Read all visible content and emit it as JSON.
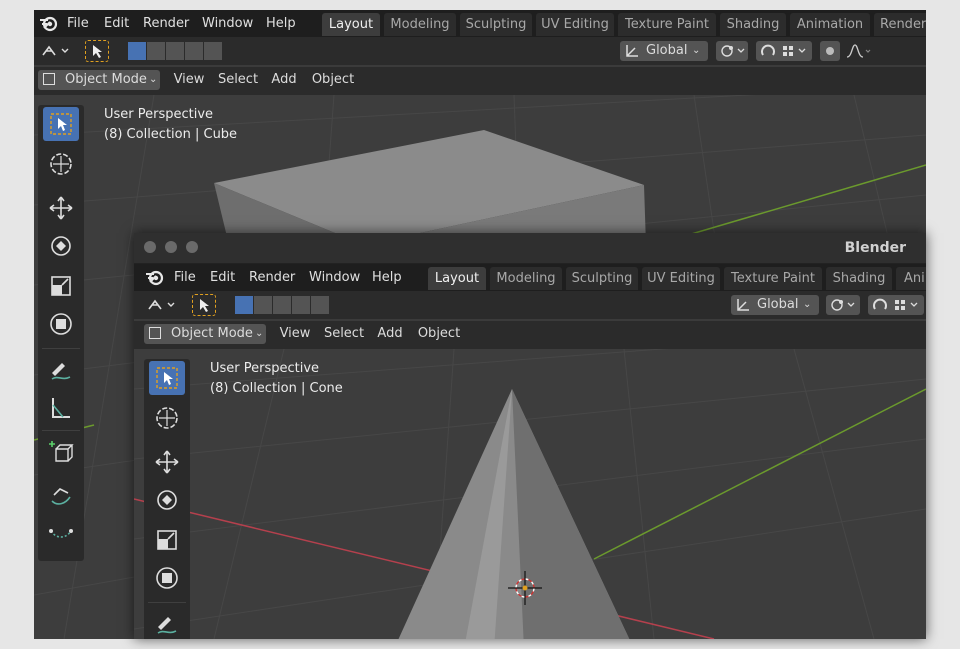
{
  "app": {
    "title": "Blender"
  },
  "menu": {
    "file": "File",
    "edit": "Edit",
    "render": "Render",
    "window": "Window",
    "help": "Help"
  },
  "workspace_tabs": [
    "Layout",
    "Modeling",
    "Sculpting",
    "UV Editing",
    "Texture Paint",
    "Shading",
    "Animation",
    "Render"
  ],
  "workspace_tabs_front": [
    "Layout",
    "Modeling",
    "Sculpting",
    "UV Editing",
    "Texture Paint",
    "Shading",
    "Ani"
  ],
  "active_tab": "Layout",
  "header": {
    "mode": "Object Mode",
    "view": "View",
    "select": "Select",
    "add": "Add",
    "object": "Object",
    "orientation": "Global"
  },
  "back_viewport": {
    "perspective": "User Perspective",
    "collection": "(8) Collection | Cube"
  },
  "front_viewport": {
    "perspective": "User Perspective",
    "collection": "(8) Collection | Cone"
  },
  "colors": {
    "accent": "#4772b3",
    "x_axis": "#b5404d",
    "y_axis": "#6b9a2d",
    "bg": "#3d3d3d"
  }
}
